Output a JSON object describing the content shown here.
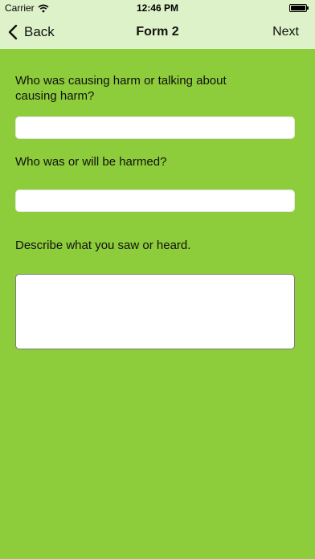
{
  "status_bar": {
    "carrier": "Carrier",
    "time": "12:46 PM",
    "wifi_icon": "wifi-icon",
    "battery_icon": "battery-icon",
    "battery_level": 1.0
  },
  "nav_bar": {
    "back_label": "Back",
    "back_icon": "chevron-left-icon",
    "title": "Form 2",
    "next_label": "Next"
  },
  "form": {
    "q1_label": "Who was causing harm or talking about causing harm?",
    "q1_value": "",
    "q2_label": "Who was or will be harmed?",
    "q2_value": "",
    "q3_label": "Describe what you saw or heard.",
    "q3_value": ""
  },
  "colors": {
    "nav_background": "#ddf2c8",
    "page_background": "#8dcc3a",
    "field_background": "#ffffff"
  }
}
